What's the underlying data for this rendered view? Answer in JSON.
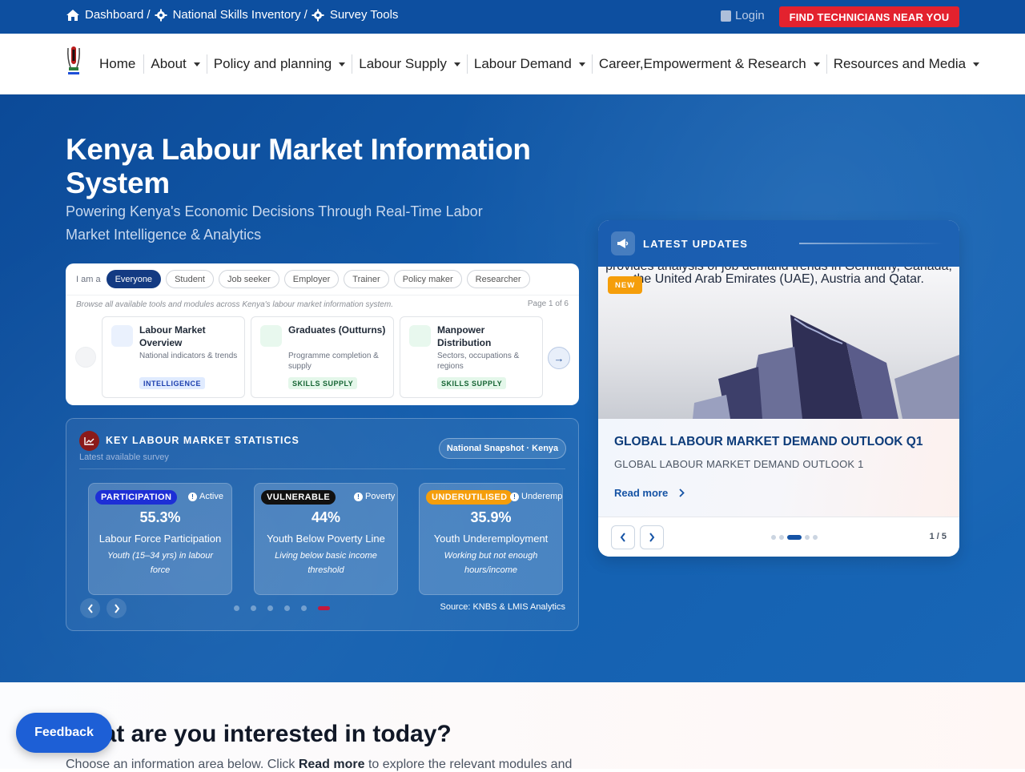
{
  "topbar": {
    "breadcrumbs": [
      "Dashboard",
      "National Skills Inventory",
      "Survey Tools"
    ],
    "separator": "/",
    "login": "Login",
    "find_button": "FIND TECHNICIANS NEAR YOU"
  },
  "nav": {
    "items": [
      "Home",
      "About",
      "Policy and planning",
      "Labour Supply",
      "Labour Demand",
      "Career,Empowerment & Research",
      "Resources and Media"
    ]
  },
  "hero": {
    "title": "Kenya Labour Market Information System",
    "subtitle": "Powering Kenya's Economic Decisions Through Real-Time Labor Market Intelligence & Analytics"
  },
  "persona": {
    "label": "I am a",
    "chips": [
      "Everyone",
      "Student",
      "Job seeker",
      "Employer",
      "Trainer",
      "Policy maker",
      "Researcher"
    ],
    "active_chip": "Everyone",
    "note": "Browse all available tools and modules across Kenya's labour market information system.",
    "page": "Page 1 of 6",
    "next_arrow": "→",
    "cards": [
      {
        "title": "Labour Market Overview",
        "desc": "National indicators & trends",
        "tag": "INTELLIGENCE",
        "tag_color": "#1e40af",
        "tag_bg": "#e0ebff",
        "icon_bg": "#eaf1fd"
      },
      {
        "title": "Graduates (Outturns)",
        "desc": "Programme completion & supply",
        "tag": "SKILLS SUPPLY",
        "tag_color": "#166534",
        "tag_bg": "#e4f7ea",
        "icon_bg": "#e8f8ee"
      },
      {
        "title": "Manpower Distribution",
        "desc": "Sectors, occupations & regions",
        "tag": "SKILLS SUPPLY",
        "tag_color": "#166534",
        "tag_bg": "#e4f7ea",
        "icon_bg": "#e8f8ee"
      }
    ]
  },
  "stats": {
    "title": "KEY LABOUR MARKET STATISTICS",
    "subtitle": "Latest available survey",
    "snapshot": "National Snapshot · Kenya",
    "source": "Source: KNBS & LMIS Analytics",
    "cards": [
      {
        "badge": "PARTICIPATION",
        "badge_color": "#1d2fd6",
        "kind": "Active",
        "value": "55.3%",
        "label": "Labour Force Participation",
        "detail": "Youth (15–34 yrs) in labour force"
      },
      {
        "badge": "VULNERABLE",
        "badge_color": "#111111",
        "kind": "Poverty",
        "value": "44%",
        "label": "Youth Below Poverty Line",
        "detail": "Living below basic income threshold"
      },
      {
        "badge": "UNDERUTILISED",
        "badge_color": "#f59e0b",
        "kind": "Underemployed",
        "value": "35.9%",
        "label": "Youth Underemployment",
        "detail": "Working but not enough hours/income"
      }
    ],
    "dot_count": 6,
    "active_dot": 5
  },
  "updates": {
    "title": "LATEST UPDATES",
    "image_text": "provides analysis of job demand trends in Germany, Canada, the United Arab Emirates (UAE), Austria and Qatar.",
    "new_tag": "NEW",
    "headline": "GLOBAL LABOUR MARKET DEMAND OUTLOOK Q1",
    "summary": "GLOBAL LABOUR MARKET DEMAND OUTLOOK 1",
    "read_more": "Read more",
    "counter": "1 / 5",
    "active_dot": 2
  },
  "interest": {
    "title": "What are you interested in today?",
    "subtitle_pre": "Choose an information area below. Click ",
    "subtitle_bold": "Read more",
    "subtitle_post": " to explore the relevant modules and"
  },
  "feedback": "Feedback",
  "colors": {
    "brand": "#0d4fa0",
    "accent_red": "#e3222e",
    "navy": "#133a82"
  }
}
